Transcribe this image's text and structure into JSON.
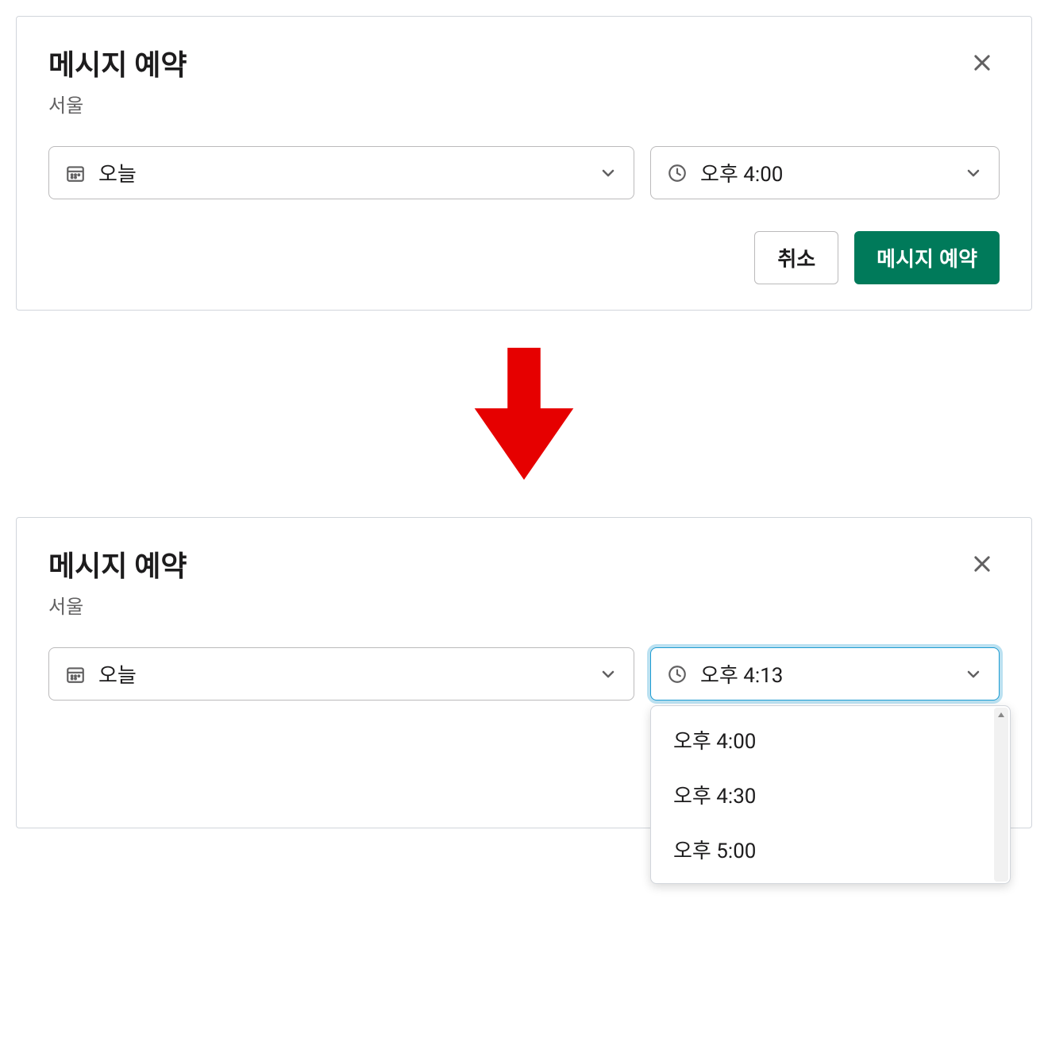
{
  "dialog1": {
    "title": "메시지 예약",
    "subtitle": "서울",
    "date_value": "오늘",
    "time_value": "오후 4:00",
    "cancel_label": "취소",
    "submit_label": "메시지 예약"
  },
  "dialog2": {
    "title": "메시지 예약",
    "subtitle": "서울",
    "date_value": "오늘",
    "time_value": "오후 4:13",
    "dropdown_options": [
      "오후 4:00",
      "오후 4:30",
      "오후 5:00"
    ]
  },
  "colors": {
    "primary": "#007a5a",
    "focus": "#1d9bd1",
    "arrow": "#e60000"
  }
}
